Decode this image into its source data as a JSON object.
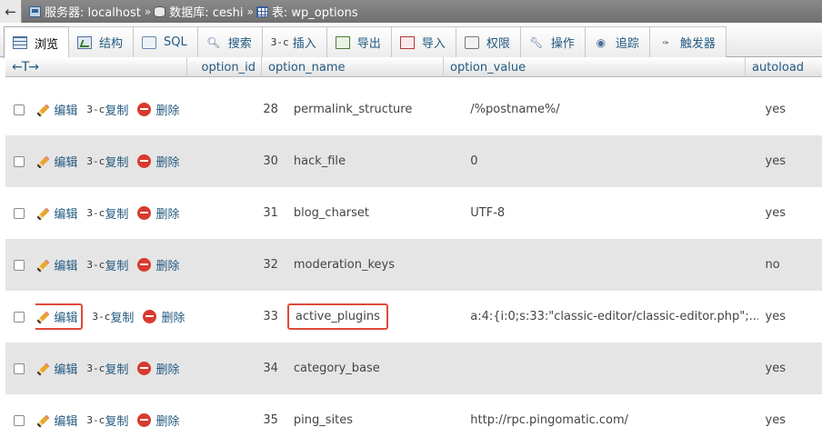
{
  "breadcrumb": {
    "server_label": "服务器: localhost",
    "db_label": "数据库: ceshi",
    "table_label": "表: wp_options",
    "separator": "»"
  },
  "tabs": [
    {
      "label": "浏览",
      "icon": "browse-icon"
    },
    {
      "label": "结构",
      "icon": "structure-icon"
    },
    {
      "label": "SQL",
      "icon": "sql-icon"
    },
    {
      "label": "搜索",
      "icon": "search-icon"
    },
    {
      "label": "插入",
      "icon": "insert-icon"
    },
    {
      "label": "导出",
      "icon": "export-icon"
    },
    {
      "label": "导入",
      "icon": "import-icon"
    },
    {
      "label": "权限",
      "icon": "privileges-icon"
    },
    {
      "label": "操作",
      "icon": "operations-icon"
    },
    {
      "label": "追踪",
      "icon": "tracking-icon"
    },
    {
      "label": "触发器",
      "icon": "triggers-icon"
    }
  ],
  "table": {
    "columns": [
      "option_id",
      "option_name",
      "option_value",
      "autoload"
    ],
    "actions": {
      "edit": "编辑",
      "copy": "复制",
      "delete": "删除"
    },
    "rows": [
      {
        "option_id": "28",
        "option_name": "permalink_structure",
        "option_value": "/%postname%/",
        "autoload": "yes"
      },
      {
        "option_id": "30",
        "option_name": "hack_file",
        "option_value": "0",
        "autoload": "yes"
      },
      {
        "option_id": "31",
        "option_name": "blog_charset",
        "option_value": "UTF-8",
        "autoload": "yes"
      },
      {
        "option_id": "32",
        "option_name": "moderation_keys",
        "option_value": "",
        "autoload": "no"
      },
      {
        "option_id": "33",
        "option_name": "active_plugins",
        "option_value": "a:4:{i:0;s:33:\"classic-editor/classic-editor.php\";...",
        "autoload": "yes"
      },
      {
        "option_id": "34",
        "option_name": "category_base",
        "option_value": "",
        "autoload": "yes"
      },
      {
        "option_id": "35",
        "option_name": "ping_sites",
        "option_value": "http://rpc.pingomatic.com/",
        "autoload": "yes"
      }
    ]
  },
  "colors": {
    "link": "#235a81",
    "highlight": "#e04a3a",
    "row_alt": "#e5e5e5"
  }
}
